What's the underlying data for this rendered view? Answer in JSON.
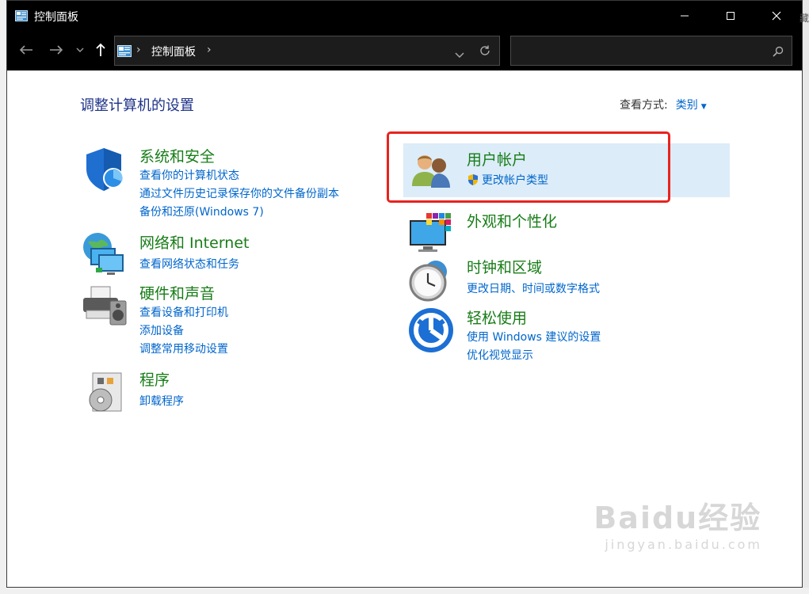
{
  "window": {
    "title": "控制面板",
    "edge_fragment": "藏"
  },
  "nav": {
    "breadcrumb": [
      "控制面板"
    ],
    "search_placeholder": ""
  },
  "main": {
    "page_title": "调整计算机的设置",
    "view_by_label": "查看方式:",
    "view_by_value": "类别"
  },
  "categories": {
    "system_security": {
      "heading": "系统和安全",
      "links": [
        "查看你的计算机状态",
        "通过文件历史记录保存你的文件备份副本",
        "备份和还原(Windows 7)"
      ]
    },
    "network": {
      "heading": "网络和 Internet",
      "links": [
        "查看网络状态和任务"
      ]
    },
    "hardware": {
      "heading": "硬件和声音",
      "links": [
        "查看设备和打印机",
        "添加设备",
        "调整常用移动设置"
      ]
    },
    "programs": {
      "heading": "程序",
      "links": [
        "卸载程序"
      ]
    },
    "user_accounts": {
      "heading": "用户帐户",
      "links": [
        "更改帐户类型"
      ]
    },
    "appearance": {
      "heading": "外观和个性化",
      "links": []
    },
    "clock_region": {
      "heading": "时钟和区域",
      "links": [
        "更改日期、时间或数字格式"
      ]
    },
    "ease_of_access": {
      "heading": "轻松使用",
      "links": [
        "使用 Windows 建议的设置",
        "优化视觉显示"
      ]
    }
  },
  "watermark": {
    "line1": "Baidu经验",
    "line2": "jingyan.baidu.com"
  },
  "colors": {
    "title_blue": "#1e3287",
    "heading_green": "#187d18",
    "link_blue": "#0066cc",
    "highlight": "#dcecf8",
    "annotation_red": "#e8231f"
  }
}
